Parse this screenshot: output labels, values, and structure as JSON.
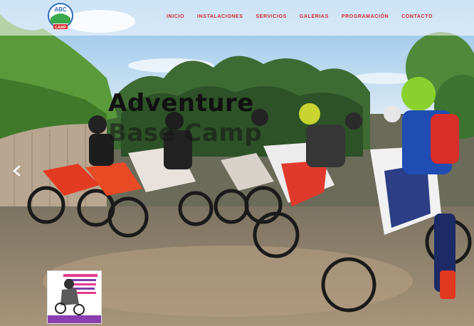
{
  "nav": {
    "items": [
      "INICIO",
      "INSTALACIONES",
      "SERVICIOS",
      "GALERIAS",
      "PROGRAMACIÓN",
      "CONTACTO"
    ]
  },
  "logo": {
    "text_top": "ABC",
    "text_bottom": "CAMP"
  },
  "hero": {
    "title_line1": "Adventure",
    "title_line2": "Base Camp"
  },
  "colors": {
    "nav_text": "#d9272b",
    "brand_green": "#3aa84b",
    "sky": "#9fc9ea"
  },
  "icons": {
    "prev": "chevron-left-icon"
  }
}
